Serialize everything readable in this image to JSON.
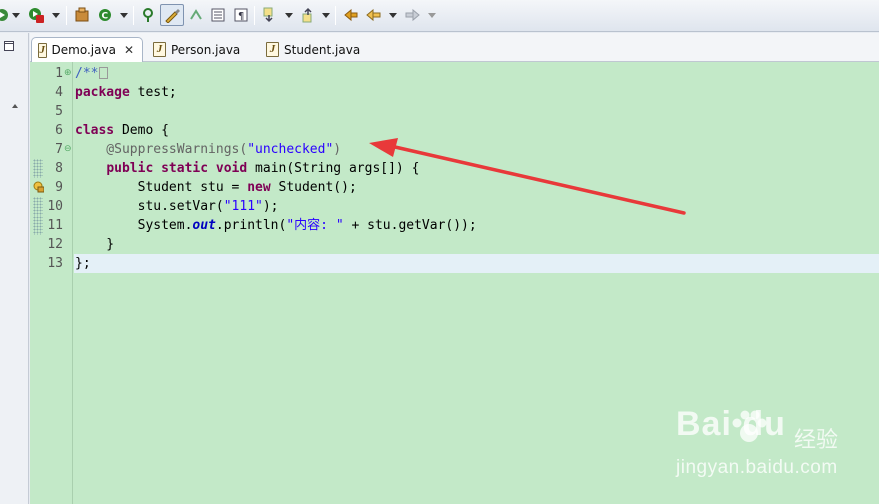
{
  "tabs": [
    {
      "label": "Demo.java",
      "active": true,
      "closable": true
    },
    {
      "label": "Person.java",
      "active": false
    },
    {
      "label": "Student.java",
      "active": false
    }
  ],
  "toolbar": {
    "icons": [
      "debug-icon",
      "run-icon",
      "external-tools-icon",
      "new-class-icon",
      "refresh-icon",
      "open-type-icon",
      "toggle-mark-occurrences-icon",
      "block-selection-icon",
      "show-whitespace-icon",
      "pilcrow-icon",
      "next-annotation-icon",
      "previous-annotation-icon",
      "last-edit-icon",
      "back-icon",
      "forward-icon"
    ]
  },
  "editor": {
    "line_numbers": [
      "1",
      "4",
      "5",
      "6",
      "7",
      "8",
      "9",
      "10",
      "11",
      "12",
      "13"
    ],
    "lines": [
      {
        "n": "1",
        "segs": [
          {
            "t": "/**",
            "c": "cmt"
          }
        ]
      },
      {
        "n": "4",
        "segs": [
          {
            "t": "package",
            "c": "kw"
          },
          {
            "t": " test;",
            "c": ""
          }
        ]
      },
      {
        "n": "5",
        "segs": []
      },
      {
        "n": "6",
        "segs": [
          {
            "t": "class",
            "c": "kw"
          },
          {
            "t": " Demo {",
            "c": ""
          }
        ]
      },
      {
        "n": "7",
        "segs": [
          {
            "t": "    @SuppressWarnings(",
            "c": "ann"
          },
          {
            "t": "\"unchecked\"",
            "c": "str"
          },
          {
            "t": ")",
            "c": "ann"
          }
        ]
      },
      {
        "n": "8",
        "segs": [
          {
            "t": "    ",
            "c": ""
          },
          {
            "t": "public",
            "c": "kw"
          },
          {
            "t": " ",
            "c": ""
          },
          {
            "t": "static",
            "c": "kw"
          },
          {
            "t": " ",
            "c": ""
          },
          {
            "t": "void",
            "c": "kw"
          },
          {
            "t": " main(String args[]) {",
            "c": ""
          }
        ]
      },
      {
        "n": "9",
        "segs": [
          {
            "t": "        Student stu = ",
            "c": ""
          },
          {
            "t": "new",
            "c": "kw"
          },
          {
            "t": " Student();",
            "c": ""
          }
        ]
      },
      {
        "n": "10",
        "segs": [
          {
            "t": "        stu.setVar(",
            "c": ""
          },
          {
            "t": "\"111\"",
            "c": "str"
          },
          {
            "t": ");",
            "c": ""
          }
        ]
      },
      {
        "n": "11",
        "segs": [
          {
            "t": "        System.",
            "c": ""
          },
          {
            "t": "out",
            "c": "fld"
          },
          {
            "t": ".println(",
            "c": ""
          },
          {
            "t": "\"内容: \"",
            "c": "str"
          },
          {
            "t": " + stu.getVar());",
            "c": ""
          }
        ]
      },
      {
        "n": "12",
        "segs": [
          {
            "t": "    }",
            "c": ""
          }
        ]
      },
      {
        "n": "13",
        "segs": [
          {
            "t": "};",
            "c": ""
          }
        ]
      }
    ],
    "current_line": "13"
  },
  "watermark": {
    "logo": "Bai du",
    "logo_suffix": "经验",
    "url": "jingyan.baidu.com"
  },
  "colors": {
    "editor_bg": "#c3e9c8",
    "current_line_bg": "#e4f0f7",
    "keyword": "#7f0055",
    "string": "#2a00ff",
    "comment": "#3f5fbf",
    "annotation": "#646464",
    "arrow": "#e8393a"
  }
}
